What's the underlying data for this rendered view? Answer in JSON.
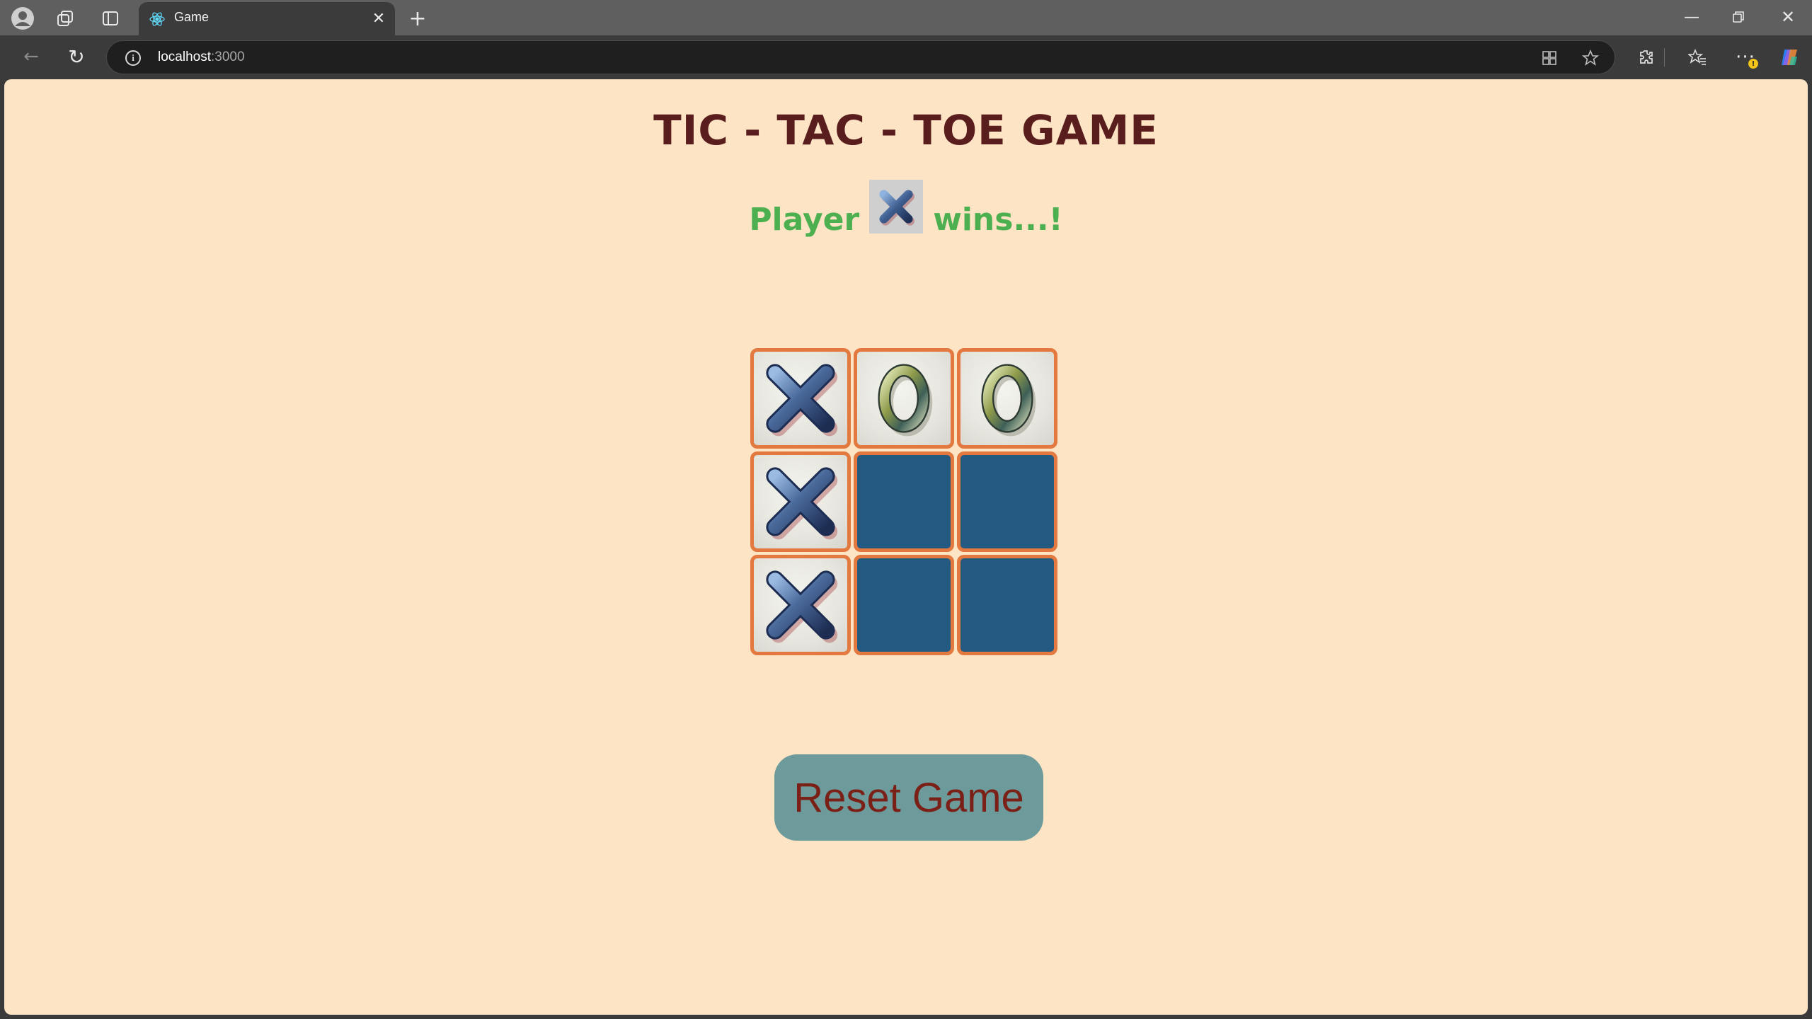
{
  "browser": {
    "tab_title": "Game",
    "url_host": "localhost",
    "url_port": ":3000",
    "tab_close_glyph": "✕",
    "new_tab_glyph": "+",
    "back_glyph": "←",
    "reload_glyph": "↻",
    "min_glyph": "—",
    "close_glyph": "✕",
    "info_glyph": "i",
    "toolbar_icons": [
      "apps-icon",
      "favorite-star-icon",
      "extensions-icon",
      "favorites-icon",
      "more-icon",
      "copilot-icon"
    ]
  },
  "game": {
    "title": "TIC - TAC - TOE GAME",
    "status_prefix": "Player",
    "status_suffix": "wins...!",
    "winner": "X",
    "board": [
      "X",
      "O",
      "O",
      "X",
      "",
      "",
      "X",
      "",
      ""
    ],
    "reset_label": "Reset Game"
  },
  "colors": {
    "page_background": "#fce4c4",
    "title": "#5a1d1d",
    "status": "#4caf50",
    "cell_border": "#e3793f",
    "empty_cell": "#245a82",
    "reset_button": "#6d9a9b",
    "reset_text": "#7a2016"
  }
}
